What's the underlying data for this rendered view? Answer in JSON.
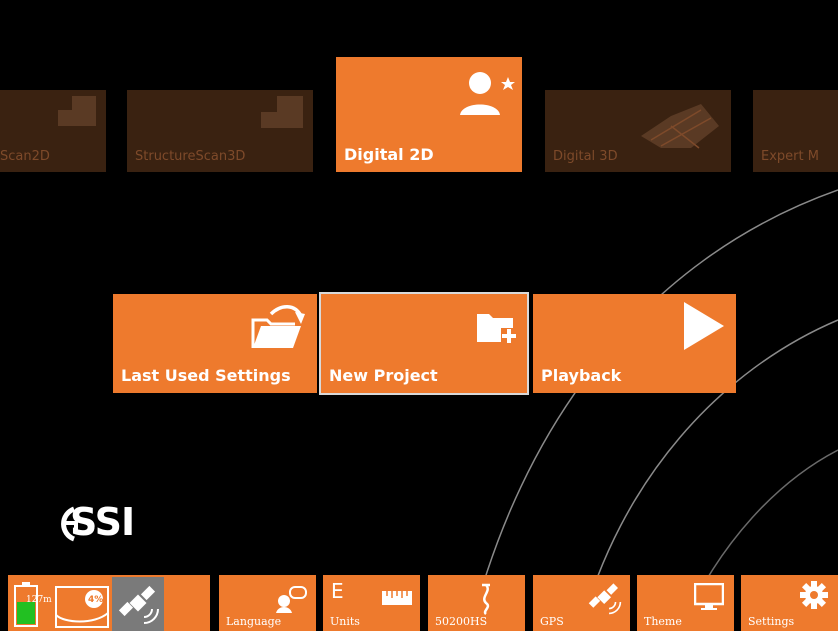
{
  "modes": {
    "items": [
      {
        "label": "Scan2D",
        "state": "dim"
      },
      {
        "label": "StructureScan3D",
        "state": "dim"
      },
      {
        "label": "Digital 2D",
        "state": "active"
      },
      {
        "label": "Digital 3D",
        "state": "dim"
      },
      {
        "label": "Expert M",
        "state": "dim"
      }
    ]
  },
  "actions": {
    "last_used": {
      "label": "Last Used Settings",
      "icon": "open-folder-icon"
    },
    "new_project": {
      "label": "New Project",
      "icon": "folder-add-icon"
    },
    "playback": {
      "label": "Playback",
      "icon": "play-icon"
    }
  },
  "logo": {
    "text": "SSI"
  },
  "status": {
    "battery_text": "127m",
    "storage_text": "4%",
    "battery_color": "#22c022"
  },
  "toolbar": {
    "language": {
      "label": "Language",
      "icon": "speech-bubble-icon"
    },
    "units": {
      "label": "Units",
      "letter": "E",
      "icon": "ruler-icon"
    },
    "antenna": {
      "label": "50200HS",
      "icon": "antenna-icon"
    },
    "gps": {
      "label": "GPS",
      "icon": "satellite-icon"
    },
    "theme": {
      "label": "Theme",
      "icon": "monitor-icon"
    },
    "settings": {
      "label": "Settings",
      "icon": "gear-icon"
    }
  },
  "colors": {
    "accent": "#ee7a2d",
    "accent_dim": "#3a2211",
    "background": "#000000"
  }
}
